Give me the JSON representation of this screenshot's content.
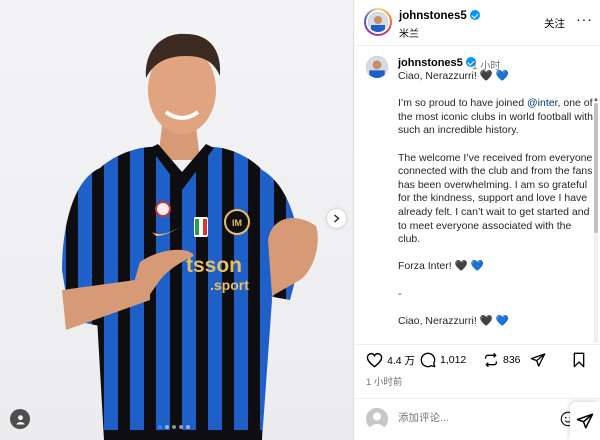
{
  "header": {
    "username": "johnstones5",
    "location": "米兰",
    "follow_label": "关注",
    "more_label": "···"
  },
  "caption": {
    "username": "johnstones5",
    "time": "1 小时",
    "first_line": "Ciao, Nerazzurri! ",
    "first_line_hearts": [
      "🖤",
      "💙"
    ],
    "paragraph1_before": "I’m so proud to have joined ",
    "paragraph1_mention": "@inter",
    "paragraph1_after": ", one of the most iconic clubs in world football with such an incredible history.",
    "paragraph2": "The welcome I’ve received from everyone connected with the club and from the fans has been overwhelming. I am so grateful for the kindness, support and love I have already felt. I can’t wait to get started and to meet everyone associated with the club.",
    "forza": "Forza Inter! ",
    "forza_hearts": [
      "🖤",
      "💙"
    ],
    "dash": "-",
    "repeat_line": "Ciao, Nerazzurri! "
  },
  "actions": {
    "likes": "4.4 万",
    "comments": "1,012",
    "reposts": "836"
  },
  "time_ago": "1 小时前",
  "comment_box": {
    "placeholder": "添加评论..."
  },
  "media": {
    "sponsor_text_top": "tsson",
    "sponsor_text_bottom": ".sport",
    "slides_total": 5,
    "slide_active": 1
  },
  "colors": {
    "jersey_blue": "#1f5fc8",
    "jersey_black": "#0d0d12",
    "link": "#00376b",
    "verified": "#0095f6",
    "sponsor_gold": "#e8c060"
  }
}
